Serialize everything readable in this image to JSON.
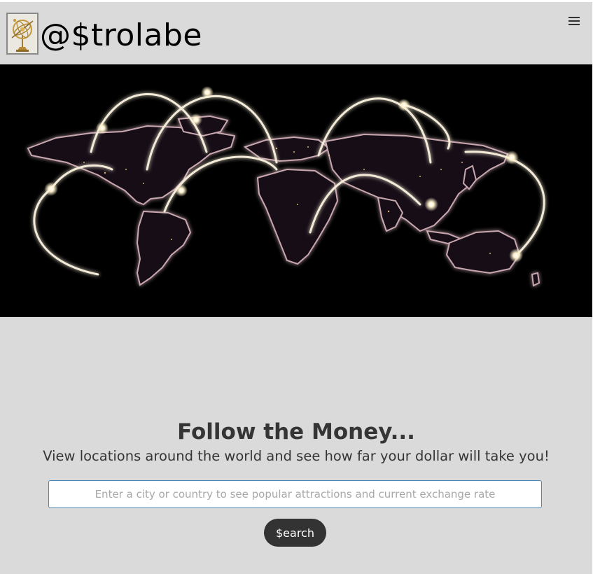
{
  "header": {
    "brand": "@$trolabe",
    "logo_icon": "astrolabe-icon",
    "menu_icon": "hamburger-menu-icon"
  },
  "hero": {
    "image": "world-map-network-arcs",
    "background": "#000000",
    "accent": "#f5e6c8"
  },
  "main": {
    "headline": "Follow the Money...",
    "subheadline": "View locations around the world and see how far your dollar will take you!",
    "search": {
      "value": "",
      "placeholder": "Enter a city or country to see popular attractions and current exchange rate"
    },
    "search_button_label": "$earch"
  },
  "colors": {
    "page_background": "#dadada",
    "text": "#353535",
    "button_background": "#333333",
    "button_text": "#ffffff",
    "input_border": "#4a86b8"
  }
}
